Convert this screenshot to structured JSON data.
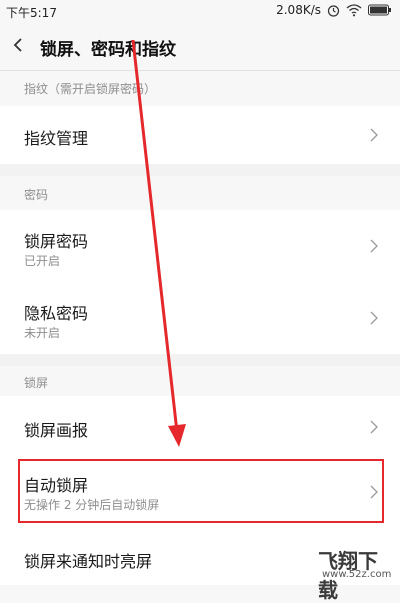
{
  "status_bar": {
    "time": "下午5:17",
    "speed": "2.08K/s",
    "icons": [
      "alarm-icon",
      "wifi-icon",
      "battery-icon"
    ]
  },
  "header": {
    "title": "锁屏、密码和指纹",
    "back_icon": "chevron-left-icon"
  },
  "sections": {
    "fingerprint_label": "指纹（需开启锁屏密码）",
    "password_label": "密码",
    "lock_label": "锁屏"
  },
  "rows": {
    "fingerprint_manage": {
      "title": "指纹管理"
    },
    "lock_password": {
      "title": "锁屏密码",
      "subtitle": "已开启"
    },
    "privacy_password": {
      "title": "隐私密码",
      "subtitle": "未开启"
    },
    "lock_wallpaper": {
      "title": "锁屏画报"
    },
    "auto_lock": {
      "title": "自动锁屏",
      "subtitle": "无操作 2 分钟后自动锁屏"
    },
    "notify_wake": {
      "title": "锁屏来通知时亮屏"
    }
  },
  "watermark": {
    "text": "飞翔下载",
    "url": "www.52z.com"
  },
  "colors": {
    "highlight": "#e5282c",
    "background": "#f7f7f7",
    "row": "#ffffff"
  }
}
